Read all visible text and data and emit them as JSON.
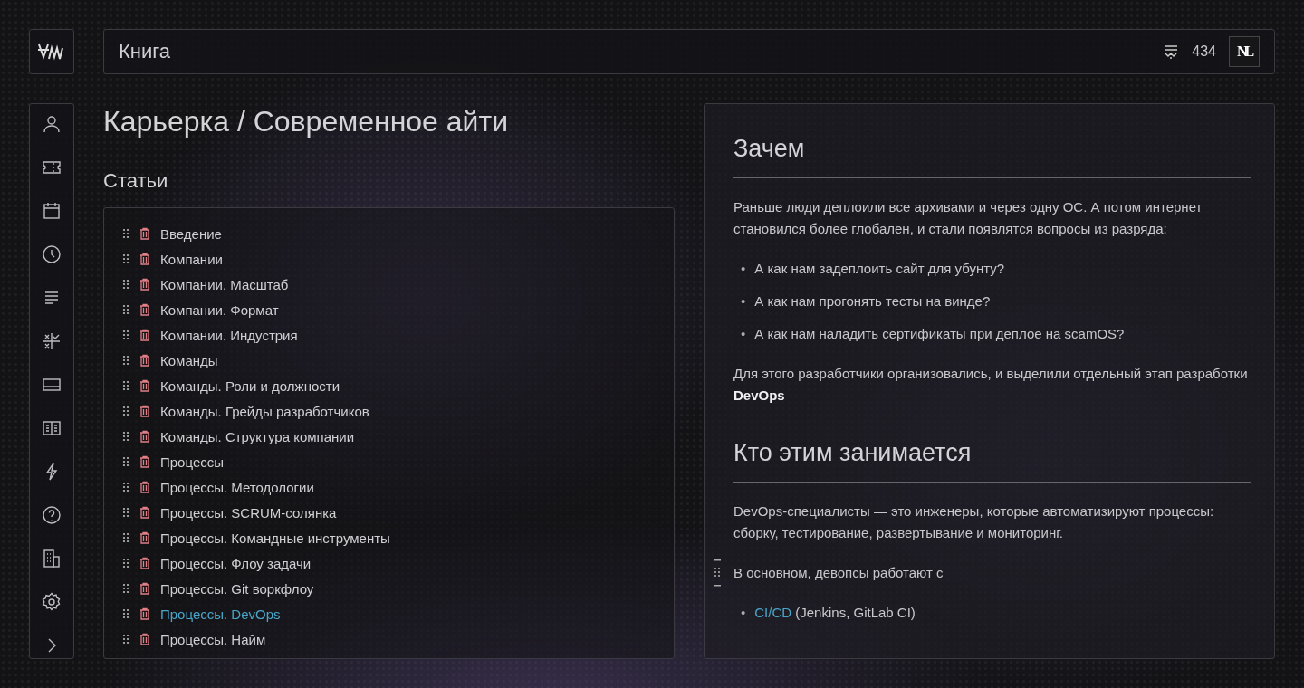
{
  "header": {
    "title": "Книга",
    "counter": "434",
    "avatar": "NL"
  },
  "sidebar": {
    "items": [
      {
        "kind": "person"
      },
      {
        "kind": "ticket"
      },
      {
        "kind": "calendar"
      },
      {
        "kind": "clock"
      },
      {
        "kind": "lines"
      },
      {
        "kind": "grid"
      },
      {
        "kind": "card"
      },
      {
        "kind": "book"
      },
      {
        "kind": "bolt"
      },
      {
        "kind": "help"
      },
      {
        "kind": "building"
      },
      {
        "kind": "gear"
      },
      {
        "kind": "chevron"
      }
    ]
  },
  "breadcrumb": "Карьерка / Современное айти",
  "articles": {
    "title": "Статьи",
    "items": [
      {
        "label": "Введение",
        "selected": false
      },
      {
        "label": "Компании",
        "selected": false
      },
      {
        "label": "Компании. Масштаб",
        "selected": false
      },
      {
        "label": "Компании. Формат",
        "selected": false
      },
      {
        "label": "Компании. Индустрия",
        "selected": false
      },
      {
        "label": "Команды",
        "selected": false
      },
      {
        "label": "Команды. Роли и должности",
        "selected": false
      },
      {
        "label": "Команды. Грейды разработчиков",
        "selected": false
      },
      {
        "label": "Команды. Структура компании",
        "selected": false
      },
      {
        "label": "Процессы",
        "selected": false
      },
      {
        "label": "Процессы. Методологии",
        "selected": false
      },
      {
        "label": "Процессы. SCRUM-солянка",
        "selected": false
      },
      {
        "label": "Процессы. Командные инструменты",
        "selected": false
      },
      {
        "label": "Процессы. Флоу задачи",
        "selected": false
      },
      {
        "label": "Процессы. Git воркфлоу",
        "selected": false
      },
      {
        "label": "Процессы. DevOps",
        "selected": true
      },
      {
        "label": "Процессы. Найм",
        "selected": false
      }
    ]
  },
  "article": {
    "blocks": [
      {
        "kind": "heading",
        "text": "Зачем"
      },
      {
        "kind": "paragraph",
        "text": "Раньше люди деплоили все архивами и через одну ОС. А потом интернет становился более глобален, и стали появлятся вопросы из разряда:"
      },
      {
        "kind": "list",
        "items": [
          {
            "marker": "•",
            "text": "А как нам задеплоить сайт для убунту?"
          },
          {
            "marker": "•",
            "text": "А как нам прогонять тесты на винде?"
          },
          {
            "marker": "•",
            "text": "А как нам наладить сертификаты при деплое на scamOS?"
          }
        ]
      },
      {
        "kind": "paragraph",
        "text": "Для этого разработчики организовались, и выделили отдельный этап разработки **DevOps**"
      },
      {
        "kind": "heading",
        "text": "Кто этим занимается"
      },
      {
        "kind": "paragraph",
        "text": "DevOps-специалисты — это инженеры, которые автоматизируют процессы: сборку, тестирование, развертывание и мониторинг."
      },
      {
        "kind": "paragraph",
        "text": "В основном, девопсы работают с",
        "handle": true
      },
      {
        "kind": "list",
        "items": [
          {
            "marker": "•",
            "link": "CI/CD",
            "text": " (Jenkins, GitLab CI)"
          }
        ]
      }
    ]
  }
}
